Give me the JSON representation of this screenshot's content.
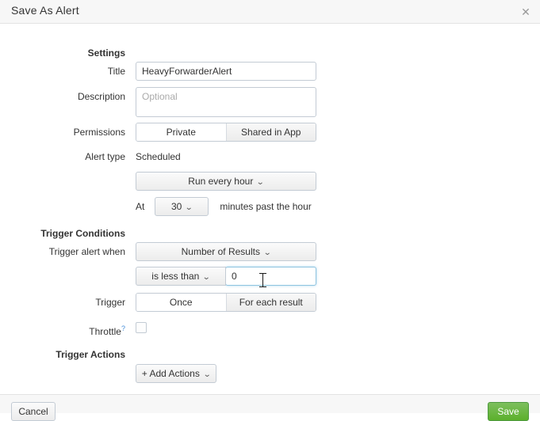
{
  "dialog": {
    "title": "Save As Alert",
    "close_icon": "close-icon"
  },
  "sections": {
    "settings": "Settings",
    "trigger_conditions": "Trigger Conditions",
    "trigger_actions": "Trigger Actions"
  },
  "fields": {
    "title": {
      "label": "Title",
      "value": "HeavyForwarderAlert",
      "placeholder": ""
    },
    "description": {
      "label": "Description",
      "value": "",
      "placeholder": "Optional"
    },
    "permissions": {
      "label": "Permissions",
      "options": [
        "Private",
        "Shared in App"
      ],
      "selected": "Private"
    },
    "alert_type": {
      "label": "Alert type",
      "value": "Scheduled"
    },
    "schedule": {
      "value": "Run every hour",
      "chevron": "chevron-down-icon"
    },
    "minute": {
      "prefix": "At",
      "value": "30",
      "suffix": "minutes past the hour",
      "chevron": "chevron-down-icon"
    },
    "trigger_alert_when": {
      "label": "Trigger alert when",
      "value": "Number of Results",
      "chevron": "chevron-down-icon"
    },
    "condition": {
      "operator": "is less than",
      "operator_chevron": "chevron-down-icon",
      "threshold": "0"
    },
    "trigger": {
      "label": "Trigger",
      "options": [
        "Once",
        "For each result"
      ],
      "selected": "Once"
    },
    "throttle": {
      "label": "Throttle",
      "help": "?",
      "checked": false
    },
    "add_actions": {
      "label": "+ Add Actions",
      "chevron": "chevron-down-icon"
    }
  },
  "footer": {
    "cancel_label": "Cancel",
    "save_label": "Save"
  },
  "colors": {
    "accent_green": "#5cb02c",
    "focus_blue": "#8ec4e0",
    "help_link": "#4a90d9",
    "header_bg": "#f7f7f7"
  }
}
